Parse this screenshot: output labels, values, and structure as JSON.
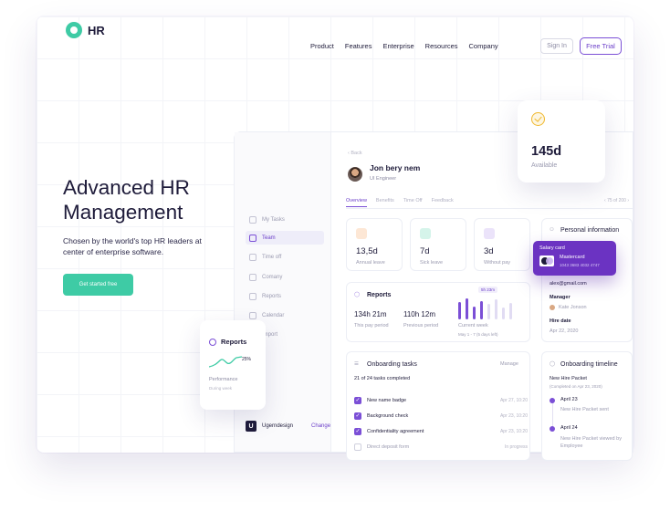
{
  "brand": {
    "logo_text": "HR",
    "accent": "#3ecba5",
    "purple": "#7b4fd6"
  },
  "nav": {
    "items": [
      "Product",
      "Features",
      "Enterprise",
      "Resources",
      "Company"
    ],
    "signin": "Sign In",
    "trial": "Free Trial"
  },
  "hero": {
    "title_hl": "Advanced",
    "title_rest": " HR",
    "title_line2": "Management",
    "subtitle": "Chosen by the world's top HR leaders at center of enterprise software.",
    "cta": "Get started free"
  },
  "sidebar": {
    "items": [
      "My Tasks",
      "Team",
      "Time off",
      "Comany",
      "Reports",
      "Calendar",
      "Import"
    ],
    "active_index": 1,
    "workspace": "Ugerndesign",
    "change": "Change"
  },
  "profile": {
    "back": "Back",
    "name": "Jon bery nem",
    "role": "UI Engineer",
    "tabs": [
      "Overview",
      "Benefits",
      "Time Off",
      "Feedback"
    ],
    "pager": "75 of 200"
  },
  "stats": [
    {
      "value": "13,5d",
      "label": "Annual leave",
      "color": "#f6a35b"
    },
    {
      "value": "7d",
      "label": "Sick leave",
      "color": "#3ecba5"
    },
    {
      "value": "3d",
      "label": "Without pay",
      "color": "#9a7ae0"
    }
  ],
  "reports_card": {
    "title": "Reports",
    "period_val": "134h 21m",
    "period_lbl": "This pay period",
    "prev_val": "110h 12m",
    "prev_lbl": "Previous period",
    "current_lbl": "Current week",
    "range_lbl": "May 1 - 7 (5 days left)",
    "tooltip": "5h 23m",
    "bars": [
      0.8,
      0.95,
      0.6,
      0.85,
      0.7,
      0.9,
      0.55,
      0.75
    ]
  },
  "onboarding": {
    "title": "Onboarding tasks",
    "manage": "Manage",
    "progress": "21 of 24 tasks completed",
    "tasks": [
      {
        "name": "New name badge",
        "date": "Apr 27, 10:20",
        "done": true
      },
      {
        "name": "Background check",
        "date": "Apr 23, 10:20",
        "done": true
      },
      {
        "name": "Confidentiality agreement",
        "date": "Apr 23, 10:20",
        "done": true
      },
      {
        "name": "Direct deposit form",
        "date": "In progress",
        "done": false
      }
    ]
  },
  "personal": {
    "title": "Personal information",
    "email": "alex@gmail.com",
    "manager_lbl": "Manager",
    "manager": "Kate Jonson",
    "hire_lbl": "Hire date",
    "hire": "Apr 22, 2020"
  },
  "timeline": {
    "title": "Onboarding timeline",
    "packet": "New Hire Packet",
    "packet_sub": "(Completed on Apr 23, 2020)",
    "events": [
      {
        "date": "April 23",
        "text": "New Hire Packet sent"
      },
      {
        "date": "April 24",
        "text": "New Hire Packet viewed by Employee"
      }
    ]
  },
  "salary_card": {
    "title": "Salary card",
    "brand": "Mastercard",
    "number": "1043 3683 4032 4747"
  },
  "available": {
    "value": "145d",
    "caption": "Available"
  },
  "reports_float": {
    "title": "Reports",
    "percent": "25%",
    "label": "Performance",
    "sub": "During week"
  }
}
